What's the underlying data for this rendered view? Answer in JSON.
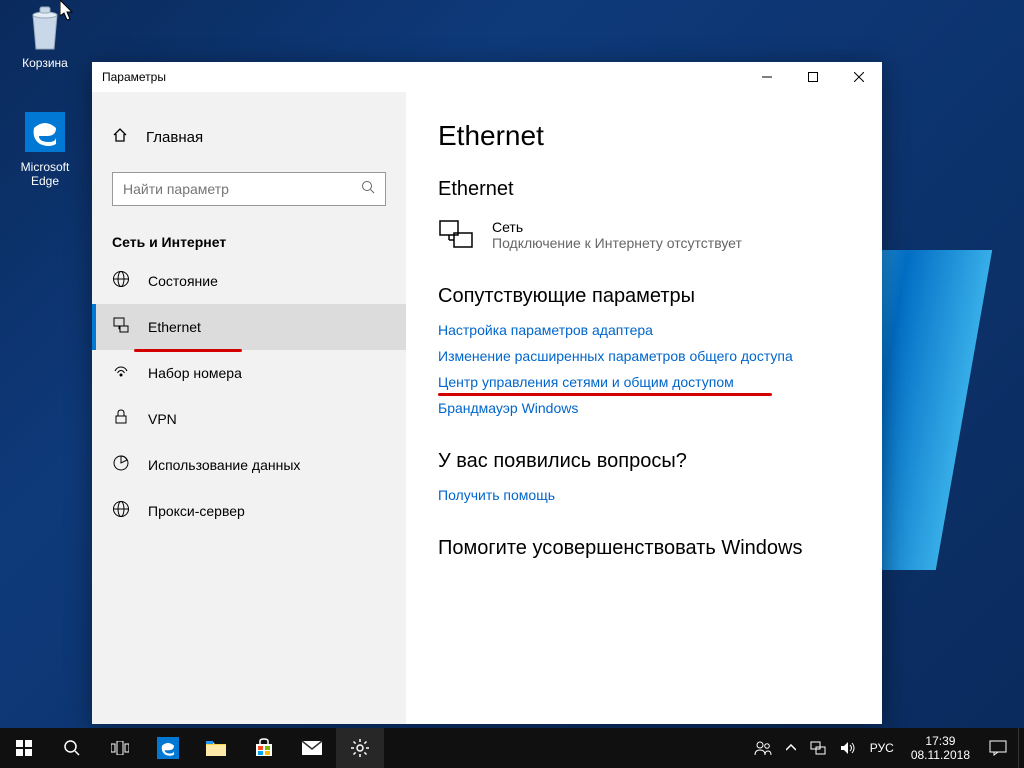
{
  "desktop": {
    "recycle_label": "Корзина",
    "edge_label": "Microsoft Edge"
  },
  "window": {
    "title": "Параметры"
  },
  "sidebar": {
    "home": "Главная",
    "search_placeholder": "Найти параметр",
    "section": "Сеть и Интернет",
    "items": [
      {
        "icon": "status",
        "label": "Состояние"
      },
      {
        "icon": "ethernet",
        "label": "Ethernet"
      },
      {
        "icon": "dialup",
        "label": "Набор номера"
      },
      {
        "icon": "vpn",
        "label": "VPN"
      },
      {
        "icon": "datausage",
        "label": "Использование данных"
      },
      {
        "icon": "proxy",
        "label": "Прокси-сервер"
      }
    ],
    "active_index": 1
  },
  "main": {
    "page_title": "Ethernet",
    "subsection": "Ethernet",
    "connection": {
      "name": "Сеть",
      "status": "Подключение к Интернету отсутствует"
    },
    "related_header": "Сопутствующие параметры",
    "links": [
      "Настройка параметров адаптера",
      "Изменение расширенных параметров общего доступа",
      "Центр управления сетями и общим доступом",
      "Брандмауэр Windows"
    ],
    "highlight_link_index": 2,
    "questions_header": "У вас появились вопросы?",
    "help_link": "Получить помощь",
    "improve_header": "Помогите усовершенствовать Windows"
  },
  "taskbar": {
    "lang": "РУС",
    "time": "17:39",
    "date": "08.11.2018"
  }
}
